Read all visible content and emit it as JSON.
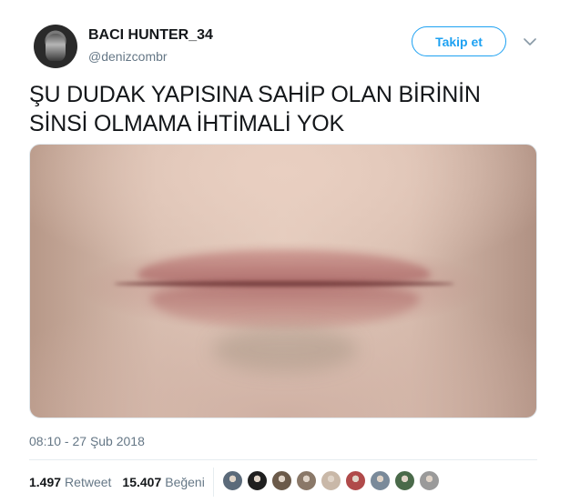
{
  "author": {
    "display_name": "BACI HUNTER_34",
    "username": "@denizcombr"
  },
  "follow_button": {
    "label": "Takip et"
  },
  "menu": {
    "icon": "chevron-down-icon"
  },
  "tweet": {
    "text_line1": "ŞU DUDAK YAPISINA SAHİP OLAN BİRİNİN",
    "text_line2": "SİNSİ OLMAMA İHTİMALİ YOK",
    "timestamp": "08:10 - 27 Şub 2018"
  },
  "stats": {
    "retweet_count": "1.497",
    "retweet_label": "Retweet",
    "like_count": "15.407",
    "like_label": "Beğeni"
  },
  "likers": [
    {
      "color": "#5b6a7a"
    },
    {
      "color": "#1f1f1f"
    },
    {
      "color": "#6b5a4a"
    },
    {
      "color": "#8a7868"
    },
    {
      "color": "#c9b8a8"
    },
    {
      "color": "#b04a4a"
    },
    {
      "color": "#7a8a9a"
    },
    {
      "color": "#4a6a4a"
    },
    {
      "color": "#9a9a9a"
    }
  ],
  "colors": {
    "accent": "#1da1f2",
    "secondary_text": "#657786",
    "primary_text": "#14171a"
  }
}
